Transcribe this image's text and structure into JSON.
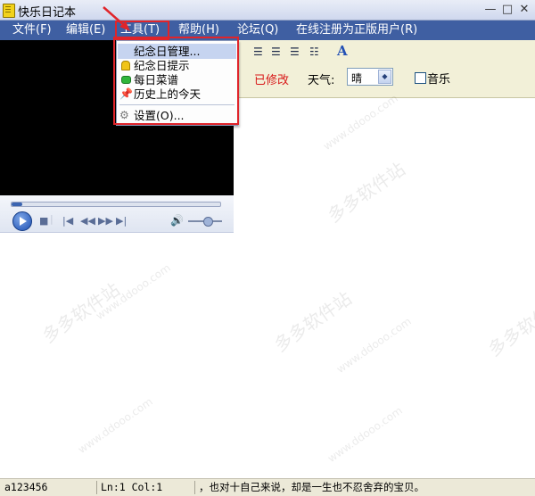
{
  "window": {
    "title": "快乐日记本",
    "minimize_glyph": "—",
    "maximize_glyph": "□",
    "close_glyph": "✕"
  },
  "menubar": {
    "items": [
      {
        "label": "文件(F)"
      },
      {
        "label": "编辑(E)"
      },
      {
        "label": "工具(T)"
      },
      {
        "label": "帮助(H)"
      },
      {
        "label": "论坛(Q)"
      },
      {
        "label": "在线注册为正版用户(R)"
      }
    ]
  },
  "tools_menu": {
    "items": [
      {
        "label": "纪念日管理...",
        "icon": "none"
      },
      {
        "label": "纪念日提示",
        "icon": "bell-icon"
      },
      {
        "label": "每日菜谱",
        "icon": "green-dish-icon"
      },
      {
        "label": "历史上的今天",
        "icon": "pin-icon"
      },
      {
        "label": "设置(O)...",
        "icon": "settings-icon"
      }
    ]
  },
  "player": {
    "seek_progress": 0.05,
    "volume_level": 0.45
  },
  "toolbar": {
    "modified_label": "已修改",
    "weather_label": "天气:",
    "weather_value": "晴",
    "music_label": "音乐",
    "music_checked": false,
    "font_button_glyph": "A"
  },
  "statusbar": {
    "user": "a123456",
    "position": "Ln:1 Col:1",
    "message": "，也对十自己来说，却是一生也不忍舍弃的宝贝。"
  },
  "watermarks": {
    "site_cn": "多多软件站",
    "site_url": "www.ddooo.com"
  },
  "colors": {
    "menubar_bg": "#3f5fa2",
    "annotation_red": "#e0242a",
    "toolbar_bg": "#f2f0d8"
  }
}
